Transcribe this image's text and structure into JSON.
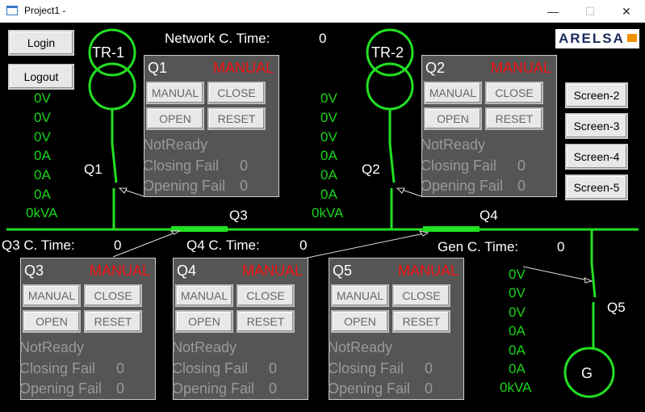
{
  "window": {
    "title": "Project1 -",
    "minimize": "—",
    "maximize": "☐",
    "close": "✕"
  },
  "logo": {
    "text": "ARELSA"
  },
  "auth": {
    "login": "Login",
    "logout": "Logout"
  },
  "screens": [
    "Screen-2",
    "Screen-3",
    "Screen-4",
    "Screen-5"
  ],
  "network_time": {
    "label": "Network C. Time:",
    "value": "0"
  },
  "q3_time": {
    "label": "Q3 C. Time:",
    "value": "0"
  },
  "q4_time": {
    "label": "Q4 C. Time:",
    "value": "0"
  },
  "gen_time": {
    "label": "Gen C. Time:",
    "value": "0"
  },
  "transformers": {
    "tr1": "TR-1",
    "tr2": "TR-2",
    "gen": "G"
  },
  "breaker_labels": {
    "q1": "Q1",
    "q2": "Q2",
    "q3": "Q3",
    "q4": "Q4",
    "q5": "Q5"
  },
  "readings_left": [
    "0V",
    "0V",
    "0V",
    "0A",
    "0A",
    "0A",
    "0kVA"
  ],
  "readings_mid": [
    "0V",
    "0V",
    "0V",
    "0A",
    "0A",
    "0A",
    "0kVA"
  ],
  "readings_right": [
    "0V",
    "0V",
    "0V",
    "0A",
    "0A",
    "0A",
    "0kVA"
  ],
  "panels": [
    {
      "name": "Q1",
      "mode": "MANUAL",
      "btn_manual": "MANUAL",
      "btn_close": "CLOSE",
      "btn_open": "OPEN",
      "btn_reset": "RESET",
      "status": "NotReady",
      "closing_label": "Closing Fail",
      "closing_value": "0",
      "opening_label": "Opening Fail",
      "opening_value": "0"
    },
    {
      "name": "Q2",
      "mode": "MANUAL",
      "btn_manual": "MANUAL",
      "btn_close": "CLOSE",
      "btn_open": "OPEN",
      "btn_reset": "RESET",
      "status": "NotReady",
      "closing_label": "Closing Fail",
      "closing_value": "0",
      "opening_label": "Opening Fail",
      "opening_value": "0"
    },
    {
      "name": "Q3",
      "mode": "MANUAL",
      "btn_manual": "MANUAL",
      "btn_close": "CLOSE",
      "btn_open": "OPEN",
      "btn_reset": "RESET",
      "status": "NotReady",
      "closing_label": "Closing Fail",
      "closing_value": "0",
      "opening_label": "Opening Fail",
      "opening_value": "0"
    },
    {
      "name": "Q4",
      "mode": "MANUAL",
      "btn_manual": "MANUAL",
      "btn_close": "CLOSE",
      "btn_open": "OPEN",
      "btn_reset": "RESET",
      "status": "NotReady",
      "closing_label": "Closing Fail",
      "closing_value": "0",
      "opening_label": "Opening Fail",
      "opening_value": "0"
    },
    {
      "name": "Q5",
      "mode": "MANUAL",
      "btn_manual": "MANUAL",
      "btn_close": "CLOSE",
      "btn_open": "OPEN",
      "btn_reset": "RESET",
      "status": "NotReady",
      "closing_label": "Closing Fail",
      "closing_value": "0",
      "opening_label": "Opening Fail",
      "opening_value": "0"
    }
  ],
  "colors": {
    "line": "#22e022",
    "reading": "#1cd41c",
    "mode": "#f01010",
    "panel": "#555555"
  }
}
